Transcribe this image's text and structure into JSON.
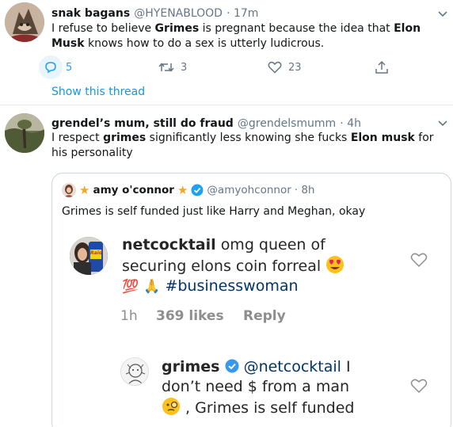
{
  "tweet1": {
    "name": "snak bagans",
    "handle": "@HYENABLOOD",
    "time": "· 17m",
    "text_parts": [
      "I refuse to believe ",
      "Grimes",
      " is pregnant because the idea that ",
      "Elon Musk",
      " knows how to do a sex is utterly ludicrous."
    ],
    "reply_count": "5",
    "retweet_count": "3",
    "like_count": "23",
    "show_thread": "Show this thread"
  },
  "tweet2": {
    "name": "grendel’s mum, still do fraud",
    "handle": "@grendelsmumm",
    "time": "· 4h",
    "text_parts": [
      "I respect ",
      "grimes",
      " significantly less knowing she fucks ",
      "Elon musk",
      " for his personality"
    ]
  },
  "quote": {
    "name": "amy o'connor",
    "handle": "@amyohconnor",
    "time": "· 8h",
    "text": "Grimes is self funded just like Harry and Meghan, okay",
    "star": "★"
  },
  "ig_comment1": {
    "username": "netcocktail",
    "text_line1": "omg queen of",
    "text_line2": "securing elons coin forreal",
    "text_line3_emoji1": "💯",
    "text_line3_emoji2": "🙏",
    "hashtag": "#businesswoman",
    "age": "1h",
    "likes": "369 likes",
    "reply": "Reply",
    "avatar_text": "Raid"
  },
  "ig_comment2": {
    "username": "grimes",
    "mention": "@netcocktail",
    "text_line1_rest": " I",
    "text_line2": "don’t need $ from a man",
    "text_line3": ", Grimes is self funded"
  },
  "colors": {
    "link_blue": "#1b95e0",
    "secondary_text": "#657786",
    "verified_blue": "#1da1f2",
    "star_orange": "#f5a623",
    "instagram_text": "#262626",
    "instagram_hashtag": "#003569"
  }
}
